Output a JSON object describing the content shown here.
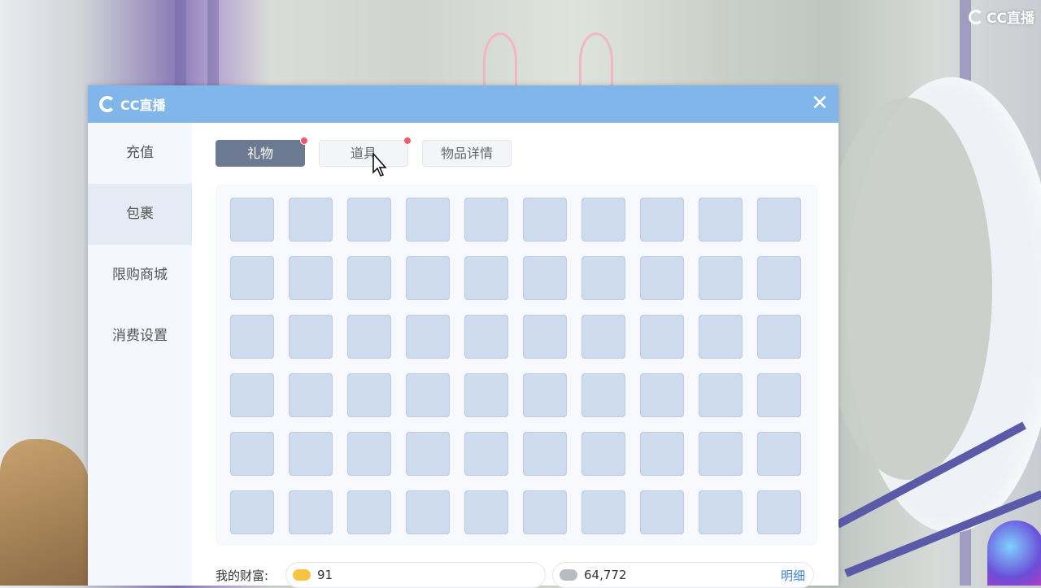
{
  "watermark": {
    "label": "CC直播"
  },
  "dialog": {
    "title": "CC直播",
    "close_symbol": "✕"
  },
  "sidebar": {
    "items": [
      {
        "label": "充值"
      },
      {
        "label": "包裹"
      },
      {
        "label": "限购商城"
      },
      {
        "label": "消费设置"
      }
    ]
  },
  "tabs": [
    {
      "label": "礼物",
      "has_badge": true
    },
    {
      "label": "道具",
      "has_badge": true
    },
    {
      "label": "物品详情",
      "has_badge": false
    }
  ],
  "inventory": {
    "rows": 6,
    "columns": 10
  },
  "wealth": {
    "label": "我的财富:",
    "gold_amount": "91",
    "silver_amount": "64,772",
    "detail_label": "明细"
  },
  "colors": {
    "titlebar": "#81b6ea",
    "active_tab": "#6b7a90",
    "badge": "#f05a6a",
    "slot": "#cfdcef",
    "link": "#3d7fd6"
  }
}
